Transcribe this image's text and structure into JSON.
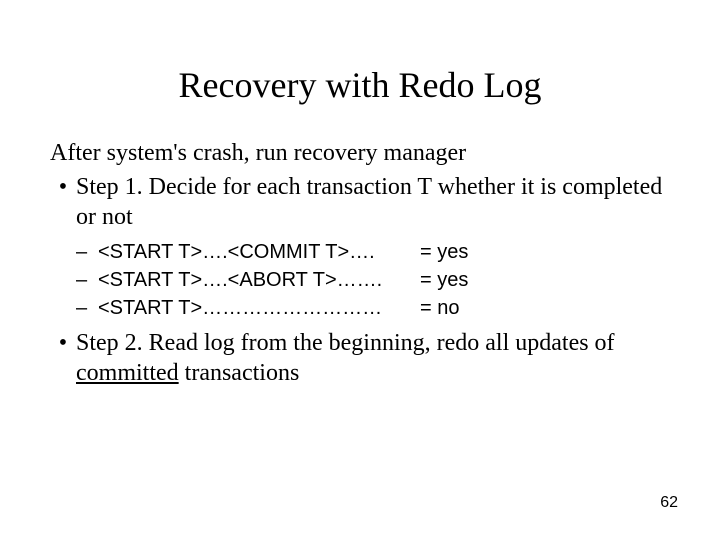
{
  "title": "Recovery with Redo Log",
  "intro": "After system's crash, run recovery manager",
  "bullets": [
    {
      "text": "Step 1. Decide for each transaction T whether it is completed or not",
      "subitems": [
        {
          "left": "<START T>….<COMMIT T>….",
          "right": "= yes"
        },
        {
          "left": "<START T>….<ABORT T>…….",
          "right": "= yes"
        },
        {
          "left": "<START T>………………………",
          "right": "= no"
        }
      ]
    },
    {
      "text_pre": "Step 2. Read log from the beginning, redo all updates of ",
      "text_underlined": "committed",
      "text_post": " transactions"
    }
  ],
  "page_number": "62"
}
